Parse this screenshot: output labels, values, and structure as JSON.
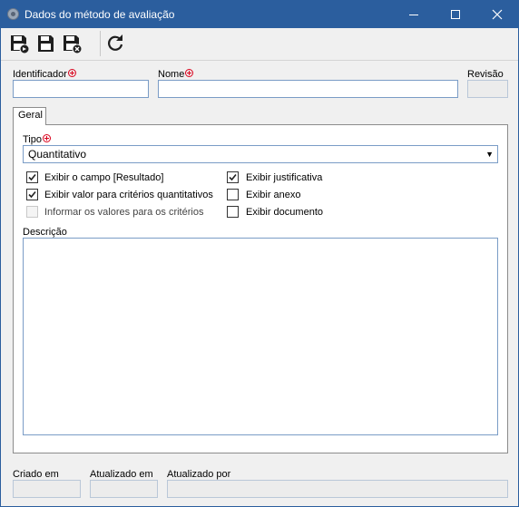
{
  "window": {
    "title": "Dados do método de avaliação"
  },
  "toolbar": {
    "buttons": [
      {
        "name": "save-and-new-icon"
      },
      {
        "name": "save-icon"
      },
      {
        "name": "save-and-close-icon"
      },
      {
        "name": "refresh-icon"
      }
    ]
  },
  "fields": {
    "identificador_label": "Identificador",
    "identificador_value": "",
    "nome_label": "Nome",
    "nome_value": "",
    "revisao_label": "Revisão",
    "revisao_value": ""
  },
  "tabs": [
    {
      "label": "Geral",
      "active": true
    }
  ],
  "geral": {
    "tipo_label": "Tipo",
    "tipo_value": "Quantitativo",
    "checkboxes_left": [
      {
        "label": "Exibir o campo [Resultado]",
        "checked": true,
        "enabled": true
      },
      {
        "label": "Exibir valor para critérios quantitativos",
        "checked": true,
        "enabled": true
      },
      {
        "label": "Informar os valores para os critérios",
        "checked": false,
        "enabled": false
      }
    ],
    "checkboxes_right": [
      {
        "label": "Exibir justificativa",
        "checked": true,
        "enabled": true
      },
      {
        "label": "Exibir anexo",
        "checked": false,
        "enabled": true
      },
      {
        "label": "Exibir documento",
        "checked": false,
        "enabled": true
      }
    ],
    "descricao_label": "Descrição",
    "descricao_value": ""
  },
  "footer": {
    "criado_em_label": "Criado em",
    "criado_em_value": "",
    "atualizado_em_label": "Atualizado em",
    "atualizado_em_value": "",
    "atualizado_por_label": "Atualizado por",
    "atualizado_por_value": ""
  },
  "colors": {
    "titlebar": "#2b5e9e",
    "required": "#d9001b",
    "input_border": "#7a9cc6"
  }
}
